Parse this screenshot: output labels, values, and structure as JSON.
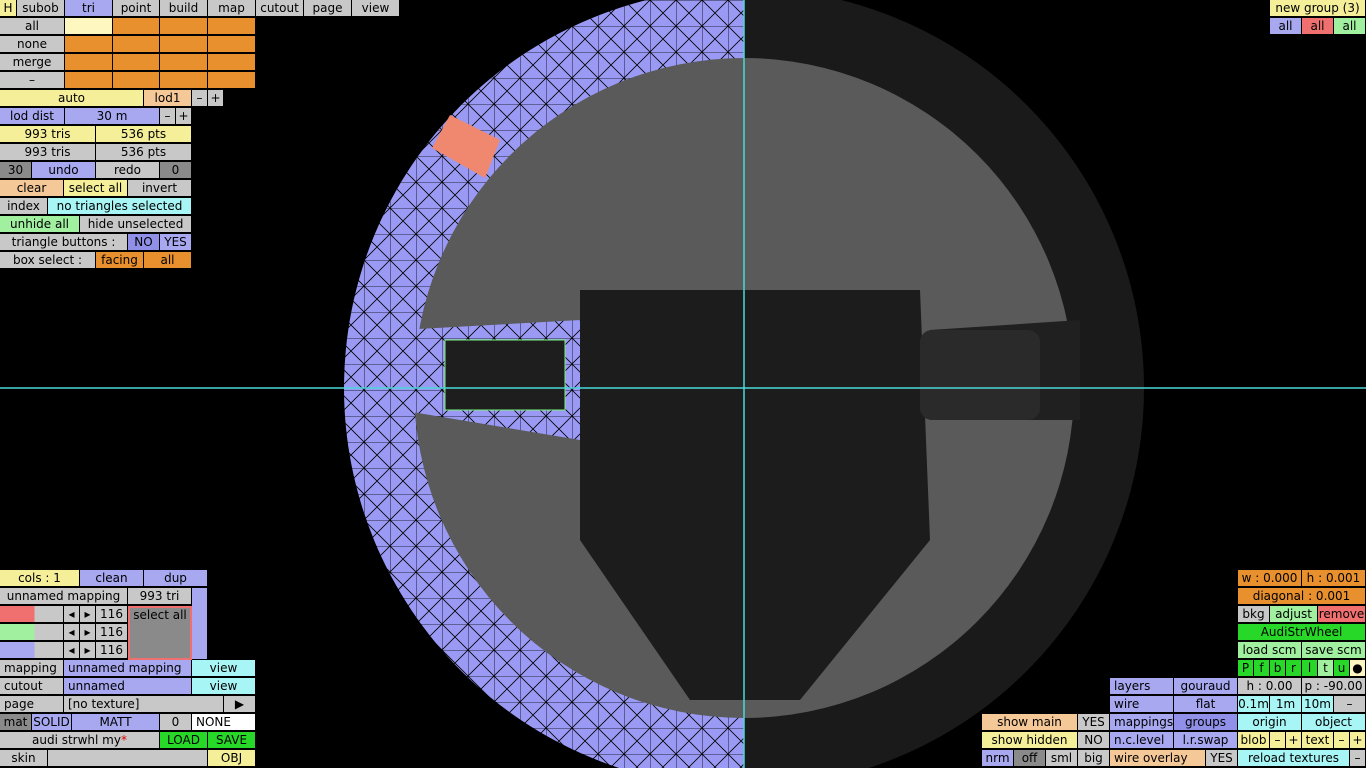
{
  "top_menu": {
    "h": "H",
    "subob": "subob",
    "tri": "tri",
    "point": "point",
    "build": "build",
    "map": "map",
    "cutout": "cutout",
    "page": "page",
    "view": "view"
  },
  "left_panel": {
    "all": "all",
    "none": "none",
    "merge": "merge",
    "dash": "–",
    "auto": "auto",
    "lod1": "lod1",
    "minus": "–",
    "plus": "+",
    "lod_dist_label": "lod dist",
    "lod_dist_value": "30 m",
    "tris1": "993 tris",
    "pts1": "536 pts",
    "tris2": "993 tris",
    "pts2": "536 pts",
    "undo_count": "30",
    "undo": "undo",
    "redo": "redo",
    "redo_count": "0",
    "clear": "clear",
    "select_all": "select all",
    "invert": "invert",
    "index": "index",
    "selection_status": "no triangles selected",
    "unhide_all": "unhide all",
    "hide_unselected": "hide unselected",
    "triangle_buttons_label": "triangle buttons :",
    "no": "NO",
    "yes": "YES",
    "box_select_label": "box select :",
    "facing": "facing",
    "box_all": "all"
  },
  "mapping_panel": {
    "cols": "cols : 1",
    "clean": "clean",
    "dup": "dup",
    "mapping_name": "unnamed mapping",
    "tri_count": "993 tri",
    "channels": [
      "116",
      "116",
      "116"
    ],
    "select_all": "select all",
    "mapping_label": "mapping",
    "mapping_value": "unnamed mapping",
    "view1": "view",
    "cutout_label": "cutout",
    "cutout_value": "unnamed",
    "view2": "view",
    "page_label": "page",
    "page_value": "[no texture]",
    "page_arrow": "▶",
    "mat": "mat",
    "solid": "SOLID",
    "matt": "MATT",
    "mat_num": "0",
    "none": "NONE",
    "file_name": "audi strwhl my",
    "modified_marker": "*",
    "load": "LOAD",
    "save": "SAVE",
    "skin": "skin",
    "obj": "OBJ"
  },
  "top_right": {
    "group_name": "new group (3)",
    "all1": "all",
    "all2": "all",
    "all3": "all"
  },
  "right_panel": {
    "w": "w : 0.000",
    "h": "h : 0.001",
    "diagonal": "diagonal : 0.001",
    "bkg": "bkg",
    "adjust": "adjust",
    "remove": "remove",
    "bkg_name": "AudiStrWheel",
    "load_scm": "load scm",
    "save_scm": "save scm",
    "letters": [
      "P",
      "f",
      "b",
      "r",
      "l",
      "t",
      "u",
      "●"
    ],
    "h_angle": "h : 0.00",
    "p_angle": "p : -90.00",
    "step1": "0.1m",
    "step2": "1m",
    "step3": "10m",
    "step_minus": "–",
    "origin": "origin",
    "object": "object",
    "blob": "blob",
    "text": "text",
    "minus": "–",
    "plus": "+",
    "reload_textures": "reload textures"
  },
  "bottom_mid": {
    "layers": "layers",
    "gouraud": "gouraud",
    "wire": "wire",
    "flat": "flat",
    "mappings": "mappings",
    "groups": "groups",
    "nc_level": "n.c.level",
    "lr_swap": "l.r.swap",
    "wire_overlay": "wire overlay",
    "wire_overlay_value": "YES"
  },
  "bottom_left2": {
    "show_main": "show main",
    "show_main_value": "YES",
    "show_hidden": "show hidden",
    "show_hidden_value": "NO",
    "nrm": "nrm",
    "off": "off",
    "sml": "sml",
    "big": "big"
  },
  "colors": {
    "mesh_fill": "#9a9af5",
    "crosshair": "#4ad8d8",
    "selected_tri": "#f08870"
  }
}
